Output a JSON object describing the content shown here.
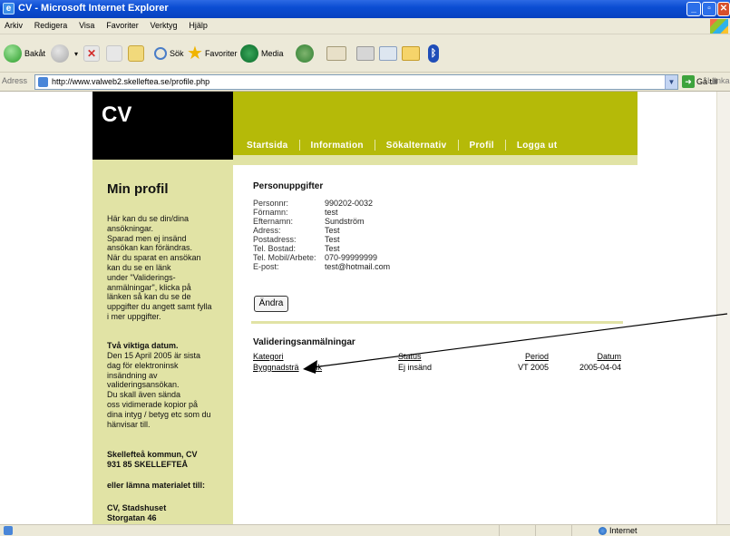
{
  "window": {
    "title": "CV - Microsoft Internet Explorer",
    "buttons": [
      "_",
      "▫",
      "✕"
    ]
  },
  "menu": [
    "Arkiv",
    "Redigera",
    "Visa",
    "Favoriter",
    "Verktyg",
    "Hjälp"
  ],
  "toolbar": {
    "back_label": "Bakåt",
    "search_label": "Sök",
    "favorites_label": "Favoriter",
    "media_label": "Media"
  },
  "address": {
    "label": "Adress",
    "url": "http://www.valweb2.skelleftea.se/profile.php",
    "go_label": "Gå till",
    "links_label": "Länkar"
  },
  "status": {
    "zone": "Internet"
  },
  "site": {
    "logo": "CV",
    "nav": [
      "Startsida",
      "Information",
      "Sökalternativ",
      "Profil",
      "Logga ut"
    ],
    "sidebar": {
      "heading": "Min profil",
      "intro_lines": [
        "Här kan du se din/dina",
        "ansökningar.",
        "Sparad men ej insänd",
        "ansökan kan förändras.",
        "När du sparat en ansökan",
        "kan du se en länk",
        "under \"Validerings-",
        "anmälningar\", klicka på",
        "länken så kan du se de",
        "uppgifter du angett samt fylla",
        "i mer uppgifter."
      ],
      "dates_heading": "Två viktiga datum.",
      "dates_lines": [
        "Den 15 April 2005 är sista",
        "dag för elektroninsk",
        "insändning av",
        "valideringsansökan.",
        "Du skall även sända",
        "oss vidimerade kopior på",
        "dina intyg / betyg etc som du",
        "hänvisar till."
      ],
      "address_lines": [
        "Skellefteå kommun, CV",
        "931 85 SKELLEFTEÅ"
      ],
      "alt_heading": "eller lämna materialet till:",
      "alt_lines": [
        "CV, Stadshuset",
        "Storgatan 46"
      ]
    },
    "personal": {
      "heading": "Personuppgifter",
      "rows": [
        {
          "k": "Personnr:",
          "v": "990202-0032"
        },
        {
          "k": "Förnamn:",
          "v": "test"
        },
        {
          "k": "Efternamn:",
          "v": "Sundström"
        },
        {
          "k": "Adress:",
          "v": "Test"
        },
        {
          "k": "Postadress:",
          "v": "Test"
        },
        {
          "k": "Tel. Bostad:",
          "v": "Test"
        },
        {
          "k": "Tel. Mobil/Arbete:",
          "v": "070-99999999"
        },
        {
          "k": "E-post:",
          "v": "test@hotmail.com"
        }
      ],
      "edit_button": "Ändra"
    },
    "validations": {
      "heading": "Valideringsanmälningar",
      "columns": [
        "Kategori",
        "Status",
        "Period",
        "Datum"
      ],
      "rows": [
        {
          "kategori": "Byggnadsträ",
          "kategori_tail": "nik",
          "status": "Ej insänd",
          "period": "VT 2005",
          "datum": "2005-04-04"
        }
      ]
    }
  }
}
